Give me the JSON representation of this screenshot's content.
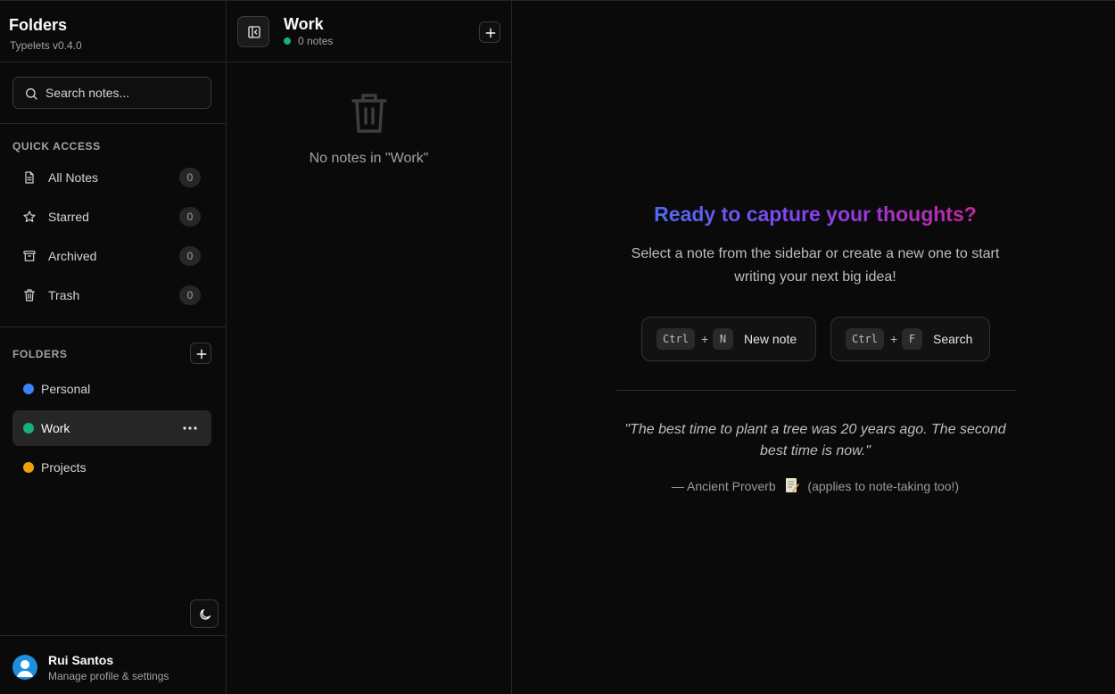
{
  "sidebar": {
    "title": "Folders",
    "version": "Typelets v0.4.0",
    "search": {
      "placeholder": "Search notes..."
    },
    "quick_access": {
      "label": "QUICK ACCESS",
      "items": [
        {
          "label": "All Notes",
          "count": "0",
          "icon": "file-text-icon"
        },
        {
          "label": "Starred",
          "count": "0",
          "icon": "star-icon"
        },
        {
          "label": "Archived",
          "count": "0",
          "icon": "archive-icon"
        },
        {
          "label": "Trash",
          "count": "0",
          "icon": "trash-icon"
        }
      ]
    },
    "folders": {
      "label": "FOLDERS",
      "items": [
        {
          "label": "Personal",
          "color": "#3b82f6"
        },
        {
          "label": "Work",
          "color": "#14b07f"
        },
        {
          "label": "Projects",
          "color": "#f59e0b"
        }
      ]
    },
    "user": {
      "name": "Rui Santos",
      "subtitle": "Manage profile & settings"
    }
  },
  "notes_panel": {
    "title": "Work",
    "count_text": "0 notes",
    "empty_text": "No notes in \"Work\""
  },
  "main": {
    "headline": "Ready to capture your thoughts?",
    "subtitle": "Select a note from the sidebar or create a new one to start writing your next big idea!",
    "shortcuts": [
      {
        "mod": "Ctrl",
        "plus": "+",
        "key": "N",
        "label": "New note"
      },
      {
        "mod": "Ctrl",
        "plus": "+",
        "key": "F",
        "label": "Search"
      }
    ],
    "quote": "\"The best time to plant a tree was 20 years ago. The second best time is now.\"",
    "attribution_prefix": "— Ancient Proverb",
    "attribution_suffix": "(applies to note-taking too!)"
  },
  "colors": {
    "accent_gradient": [
      "#4f6bef",
      "#8b3ff0",
      "#c2279d"
    ],
    "status_green": "#14b07f"
  }
}
